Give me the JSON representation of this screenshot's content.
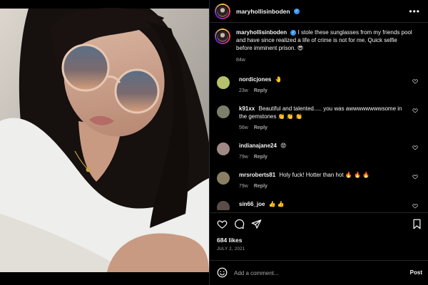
{
  "post": {
    "username": "maryhollisinboden",
    "verified_glyph": "✓",
    "more_glyph": "•••",
    "caption": "I stole these sunglasses from my friends pool and have since realized a life of crime is not for me. Quick selfie before imminent prison. 😎",
    "caption_age": "84w",
    "likes": "684 likes",
    "date": "JULY 2, 2021"
  },
  "comments": [
    {
      "name": "nordicjones",
      "text": "🤚",
      "age": "23w",
      "reply": "Reply",
      "avatar_color": "#b7c06a"
    },
    {
      "name": "k91xx",
      "text": "Beautiful and talented..... you was awwwwwwwwsome in the gemstones 👏 👏 👏",
      "age": "56w",
      "reply": "Reply",
      "avatar_color": "#7c7f6c"
    },
    {
      "name": "indianajane24",
      "text": "😡",
      "age": "79w",
      "reply": "Reply",
      "avatar_color": "#a08a86"
    },
    {
      "name": "mrsroberts81",
      "text": "Holy fuck! Hotter than hot 🔥 🔥 🔥",
      "age": "79w",
      "reply": "Reply",
      "avatar_color": "#8a7f62"
    },
    {
      "name": "sin66_joe",
      "text": "👍 👍",
      "age": "",
      "reply": "",
      "avatar_color": "#5a4c46"
    }
  ],
  "add_comment": {
    "placeholder": "Add a comment...",
    "post_label": "Post"
  },
  "icons": [
    "avatar",
    "verified-badge-icon",
    "more-options-icon",
    "heart-icon",
    "comment-icon",
    "share-icon",
    "bookmark-icon",
    "emoji-icon"
  ],
  "colors": {
    "background": "#000000",
    "text": "#f5f5f5",
    "muted": "#a8a8a8",
    "verified": "#3897f0",
    "divider": "#262626"
  }
}
